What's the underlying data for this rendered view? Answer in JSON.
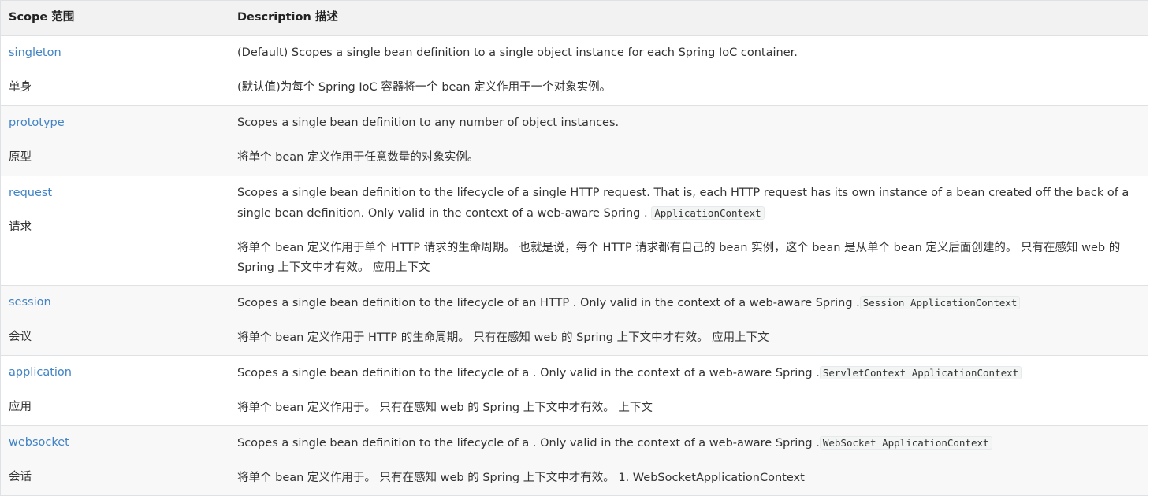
{
  "header": {
    "scope": "Scope 范围",
    "description": "Description 描述"
  },
  "rows": [
    {
      "scope": "singleton",
      "scope_cn": "单身",
      "desc_en": "(Default) Scopes a single bean definition to a single object instance for each Spring IoC container.",
      "codes": [],
      "desc_cn": "(默认值)为每个 Spring IoC 容器将一个 bean 定义作用于一个对象实例。"
    },
    {
      "scope": "prototype",
      "scope_cn": "原型",
      "desc_en": "Scopes a single bean definition to any number of object instances.",
      "codes": [],
      "desc_cn": "将单个 bean 定义作用于任意数量的对象实例。"
    },
    {
      "scope": "request",
      "scope_cn": "请求",
      "desc_en": "Scopes a single bean definition to the lifecycle of a single HTTP request. That is, each HTTP request has its own instance of a bean created off the back of a single bean definition. Only valid in the context of a web-aware Spring .",
      "codes": [
        "ApplicationContext"
      ],
      "desc_cn": "将单个 bean 定义作用于单个 HTTP 请求的生命周期。 也就是说，每个 HTTP 请求都有自己的 bean 实例，这个 bean 是从单个 bean 定义后面创建的。 只有在感知 web 的 Spring 上下文中才有效。 应用上下文"
    },
    {
      "scope": "session",
      "scope_cn": "会议",
      "desc_en": "Scopes a single bean definition to the lifecycle of an HTTP . Only valid in the context of a web-aware Spring .",
      "codes": [
        "Session ApplicationContext"
      ],
      "desc_cn": "将单个 bean 定义作用于 HTTP 的生命周期。 只有在感知 web 的 Spring 上下文中才有效。 应用上下文"
    },
    {
      "scope": "application",
      "scope_cn": "应用",
      "desc_en": "Scopes a single bean definition to the lifecycle of a . Only valid in the context of a web-aware Spring .",
      "codes": [
        "ServletContext ApplicationContext"
      ],
      "desc_cn": "将单个 bean 定义作用于。 只有在感知 web 的 Spring 上下文中才有效。 上下文"
    },
    {
      "scope": "websocket",
      "scope_cn": "会话",
      "desc_en": "Scopes a single bean definition to the lifecycle of a . Only valid in the context of a web-aware Spring .",
      "codes": [
        "WebSocket ApplicationContext"
      ],
      "desc_cn": "将单个 bean 定义作用于。 只有在感知 web 的 Spring 上下文中才有效。 1. WebSocketApplicationContext"
    }
  ],
  "colors": {
    "link": "#4183c4",
    "header_bg": "#f2f2f2",
    "border": "#dfe2e5",
    "code_bg": "#f3f4f4"
  }
}
